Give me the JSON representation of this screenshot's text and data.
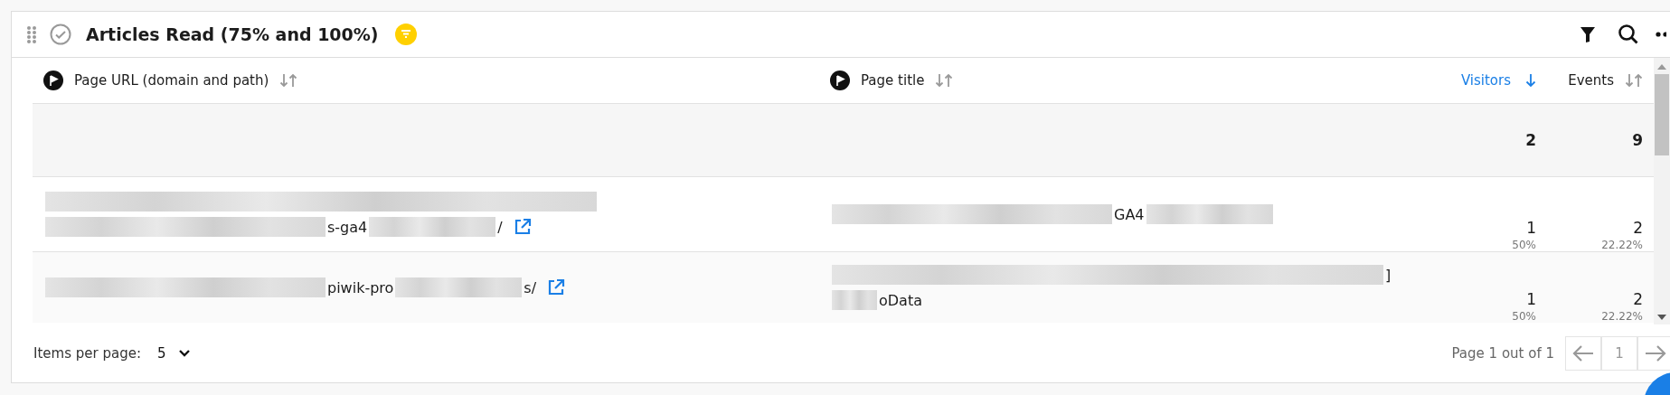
{
  "widget": {
    "title": "Articles Read (75% and 100%)",
    "filter_active": true
  },
  "table": {
    "columns": [
      {
        "label": "Page URL (domain and path)",
        "kind": "dimension",
        "sorted": false
      },
      {
        "label": "Page title",
        "kind": "dimension",
        "sorted": false
      },
      {
        "label": "Visitors",
        "kind": "metric",
        "sorted": true
      },
      {
        "label": "Events",
        "kind": "metric",
        "sorted": false
      }
    ],
    "totals": [
      "2",
      "9"
    ],
    "rows": [
      {
        "url": [
          [
            {
              "kind": "redacted"
            }
          ],
          [
            {
              "kind": "redacted"
            },
            {
              "kind": "text",
              "text": "s-ga4"
            },
            {
              "kind": "redacted"
            },
            {
              "kind": "text",
              "text": "/"
            }
          ]
        ],
        "title": [
          [
            {
              "kind": "redacted"
            },
            {
              "kind": "text",
              "text": "GA4"
            },
            {
              "kind": "redacted"
            }
          ]
        ],
        "visitors": "1",
        "visitors_share": "50%",
        "events": "2",
        "events_share": "22.22%"
      },
      {
        "url": [
          [
            {
              "kind": "redacted"
            },
            {
              "kind": "text",
              "text": "piwik-pro"
            },
            {
              "kind": "redacted"
            },
            {
              "kind": "text",
              "text": "s/"
            }
          ]
        ],
        "title": [
          [
            {
              "kind": "redacted"
            },
            {
              "kind": "text",
              "text": "]"
            }
          ],
          [
            {
              "kind": "redacted"
            },
            {
              "kind": "text",
              "text": "oData"
            }
          ]
        ],
        "visitors": "1",
        "visitors_share": "50%",
        "events": "2",
        "events_share": "22.22%"
      }
    ]
  },
  "footer": {
    "items_per_page_label": "Items per page:",
    "items_per_page": "5",
    "page_info": "Page 1 out of 1",
    "current_page": "1"
  }
}
